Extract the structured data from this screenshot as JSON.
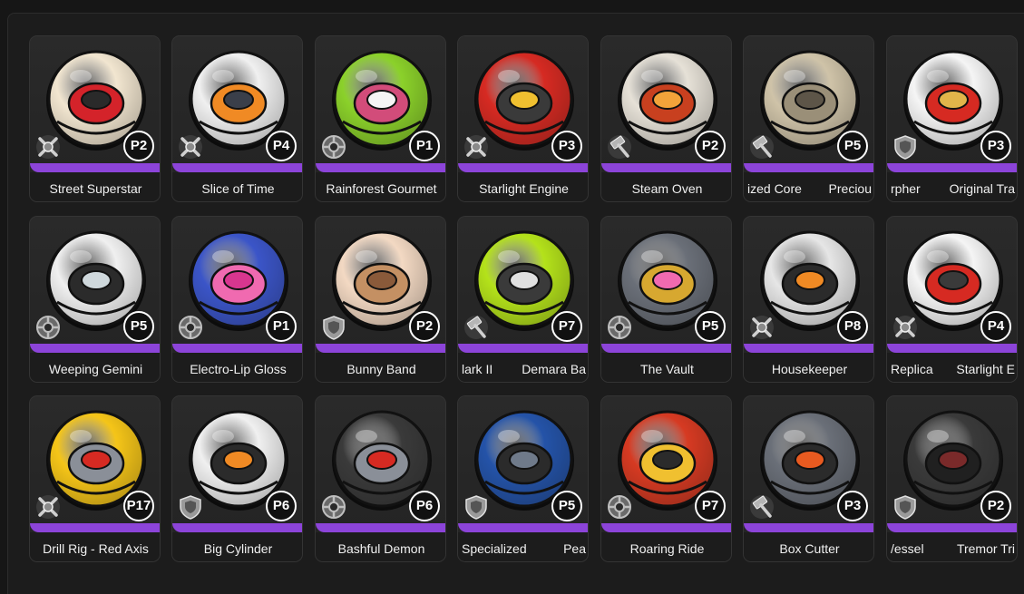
{
  "cards": [
    {
      "name": "Street Superstar",
      "level": "P2",
      "type": "drill",
      "colors": [
        "#f2e6d0",
        "#d4232a",
        "#2a2a2a"
      ]
    },
    {
      "name": "Slice of Time",
      "level": "P4",
      "type": "drill",
      "colors": [
        "#f0f0f0",
        "#f08a24",
        "#3a3f4a"
      ]
    },
    {
      "name": "Rainforest Gourmet",
      "level": "P1",
      "type": "gear",
      "colors": [
        "#8bd12a",
        "#d24c7a",
        "#f5f5f5"
      ]
    },
    {
      "name": "Starlight Engine",
      "level": "P3",
      "type": "drill",
      "colors": [
        "#d62a22",
        "#3a3a3a",
        "#f0c030"
      ]
    },
    {
      "name": "Steam Oven",
      "level": "P2",
      "type": "hammer",
      "colors": [
        "#e6e1d7",
        "#c8401f",
        "#f2a33a"
      ]
    },
    {
      "name_left": "ized Core",
      "name_right": "Preciou",
      "level": "P5",
      "type": "hammer",
      "colors": [
        "#cfc3a8",
        "#9a8f78",
        "#5d5548"
      ]
    },
    {
      "name_left": "rpher",
      "name_right": "Original Tra",
      "level": "P3",
      "type": "shield",
      "colors": [
        "#f5f5f5",
        "#d62a22",
        "#e2b54a"
      ]
    },
    {
      "name": "Weeping Gemini",
      "level": "P5",
      "type": "gear",
      "colors": [
        "#f0f0f0",
        "#2b2b2b",
        "#cfd8dc"
      ]
    },
    {
      "name": "Electro-Lip Gloss",
      "level": "P1",
      "type": "gear",
      "colors": [
        "#3b55c8",
        "#f06ab0",
        "#d8368f"
      ]
    },
    {
      "name": "Bunny Band",
      "level": "P2",
      "type": "shield",
      "colors": [
        "#f3d9c3",
        "#c49063",
        "#8a5a3a"
      ]
    },
    {
      "name_left": "lark II",
      "name_right": "Demara Ba",
      "level": "P7",
      "type": "hammer",
      "colors": [
        "#b4e21a",
        "#3a3a3a",
        "#e0e0e0"
      ]
    },
    {
      "name": "The Vault",
      "level": "P5",
      "type": "gear",
      "colors": [
        "#6a6f78",
        "#d7a830",
        "#f06ab0"
      ]
    },
    {
      "name": "Housekeeper",
      "level": "P8",
      "type": "drill",
      "colors": [
        "#e6e6e6",
        "#2b2b2b",
        "#f08a24"
      ]
    },
    {
      "name_left": "Replica",
      "name_right": "Starlight E",
      "level": "P4",
      "type": "drill",
      "colors": [
        "#f5f5f5",
        "#d62a22",
        "#3a3a3a"
      ]
    },
    {
      "name": "Drill Rig - Red Axis",
      "level": "P17",
      "type": "drill",
      "colors": [
        "#f5c518",
        "#8a8f98",
        "#d62a22"
      ]
    },
    {
      "name": "Big Cylinder",
      "level": "P6",
      "type": "shield",
      "colors": [
        "#f0f0f0",
        "#2b2b2b",
        "#f08a24"
      ]
    },
    {
      "name": "Bashful Demon",
      "level": "P6",
      "type": "gear",
      "colors": [
        "#3a3a3a",
        "#8a8f98",
        "#d62a22"
      ]
    },
    {
      "name_left": "Specialized",
      "name_right": "Pea",
      "level": "P5",
      "type": "shield",
      "colors": [
        "#2453a8",
        "#2b2b2b",
        "#6f7a8a"
      ]
    },
    {
      "name": "Roaring Ride",
      "level": "P7",
      "type": "gear",
      "colors": [
        "#d63a22",
        "#f0c030",
        "#2b2b2b"
      ]
    },
    {
      "name": "Box Cutter",
      "level": "P3",
      "type": "hammer",
      "colors": [
        "#6a6f78",
        "#2b2b2b",
        "#e85a20"
      ]
    },
    {
      "name_left": "/essel",
      "name_right": "Tremor Tri",
      "level": "P2",
      "type": "shield",
      "colors": [
        "#3a3a3a",
        "#202020",
        "#7a2a2a"
      ]
    }
  ],
  "theme": {
    "accent": "#8c44d9",
    "card_bg": "#262626",
    "page_bg": "#161616"
  }
}
